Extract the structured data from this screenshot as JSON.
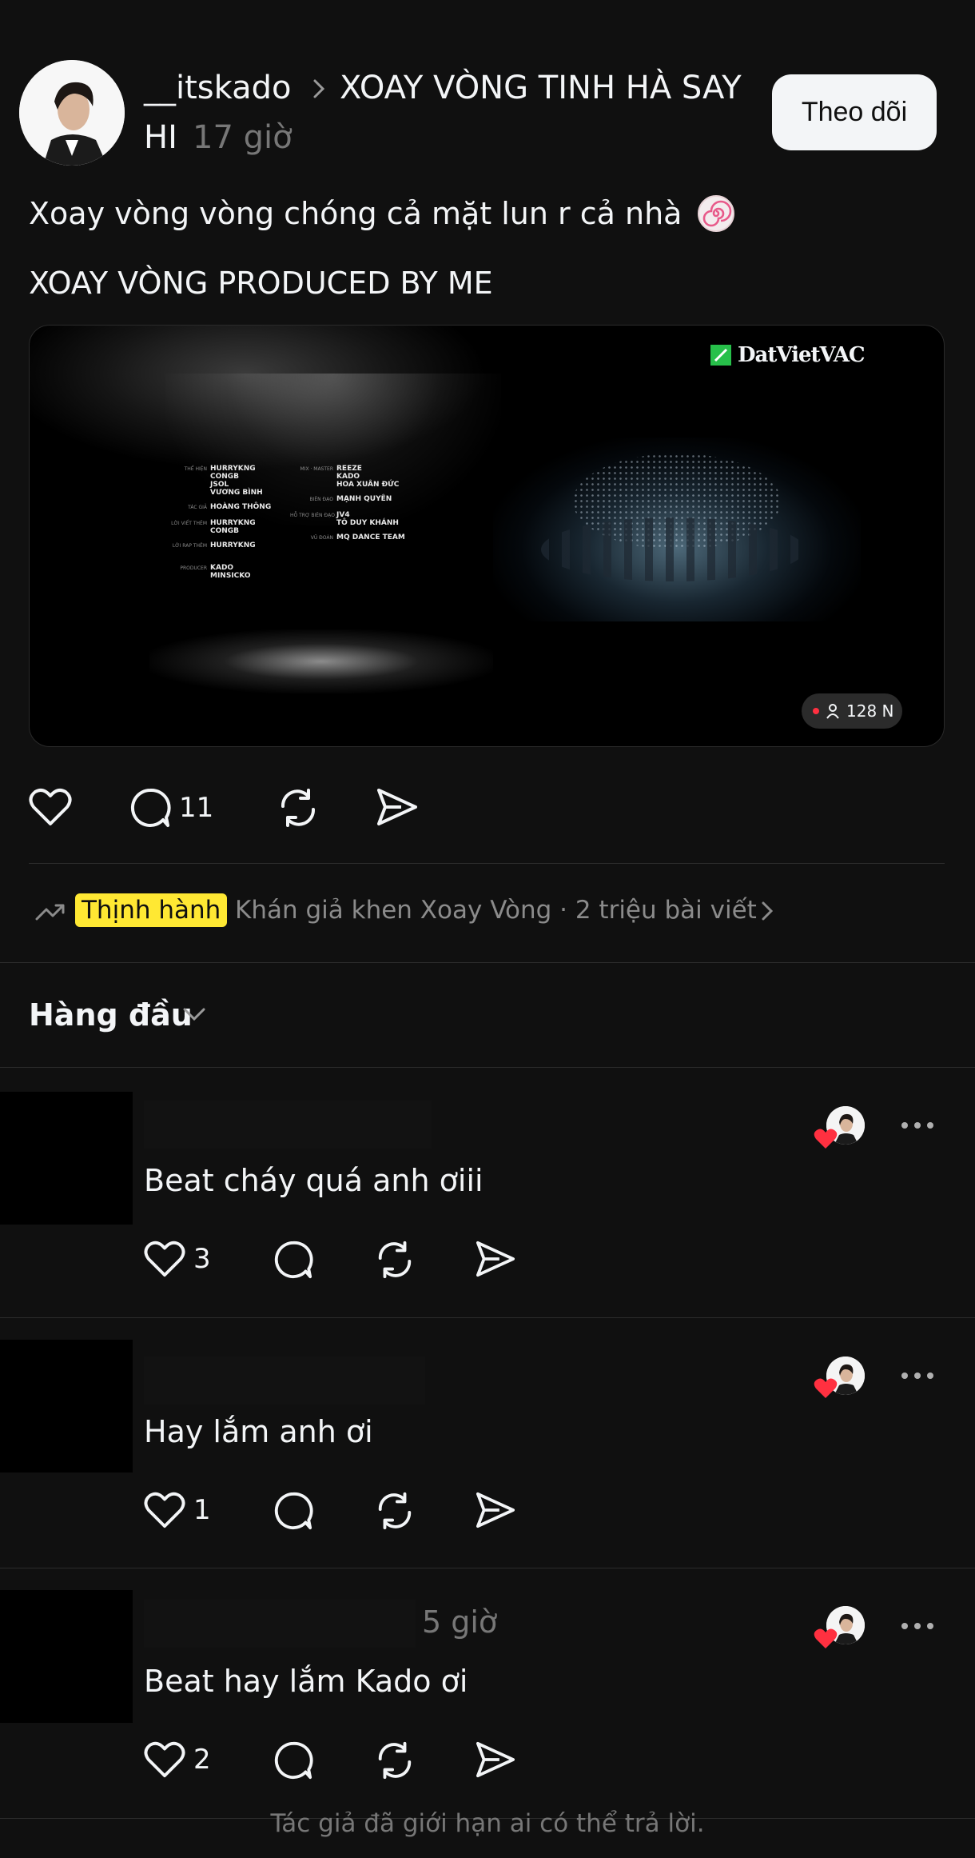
{
  "header": {
    "username": "__itskado",
    "thread_title": "XOAY VÒNG TINH HÀ SAY",
    "thread_title_cont": "HI",
    "time_ago": "17 giờ",
    "follow_label": "Theo dõi"
  },
  "post": {
    "caption_line1": "Xoay vòng vòng chóng cả mặt lun r cả nhà",
    "caption_emoji": "spiral-candy-icon",
    "caption_line2": "XOAY VÒNG PRODUCED BY ME"
  },
  "video": {
    "brand": "DatVietVAC",
    "viewers": "128 N",
    "credits_left": [
      {
        "label": "THỂ HIỆN",
        "values": [
          "HURRYKNG",
          "CONGB",
          "JSOL",
          "VƯƠNG BÌNH"
        ]
      },
      {
        "label": "TÁC GIẢ",
        "values": [
          "HOÀNG THÔNG"
        ]
      },
      {
        "label": "LỜI VIẾT THÊM",
        "values": [
          "HURRYKNG",
          "CONGB"
        ]
      },
      {
        "label": "LỜI RAP THÊM",
        "values": [
          "HURRYKNG"
        ]
      },
      {
        "label": "PRODUCER",
        "values": [
          "KADO",
          "MINSICKO"
        ]
      }
    ],
    "credits_right": [
      {
        "label": "MIX · MASTER",
        "values": [
          "REEZE",
          "KADO",
          "HOA XUÂN ĐỨC"
        ]
      },
      {
        "label": "BIÊN ĐẠO",
        "values": [
          "MẠNH QUYÊN"
        ]
      },
      {
        "label": "HỖ TRỢ BIÊN ĐẠO",
        "values": [
          "JV4",
          "TÔ DUY KHÁNH"
        ]
      },
      {
        "label": "VŨ ĐOÀN",
        "values": [
          "MQ DANCE TEAM"
        ]
      }
    ]
  },
  "actions": {
    "reply_count": "11"
  },
  "trending": {
    "badge": "Thịnh hành",
    "text": "Khán giả khen Xoay Vòng · 2 triệu bài viết"
  },
  "sort": {
    "label": "Hàng đầu"
  },
  "replies": [
    {
      "text": "Beat cháy quá anh ơiii",
      "likes": "3",
      "time": ""
    },
    {
      "text": "Hay lắm anh ơi",
      "likes": "1",
      "time": ""
    },
    {
      "text": "Beat hay lắm Kado ơi",
      "likes": "2",
      "time": "5 giờ"
    }
  ],
  "footer": {
    "note": "Tác giả đã giới hạn ai có thể trả lời."
  },
  "colors": {
    "background": "#101010",
    "text": "#f3f5f7",
    "muted": "#777777",
    "trend_highlight": "#ffe833",
    "heart_red": "#ff3040"
  }
}
